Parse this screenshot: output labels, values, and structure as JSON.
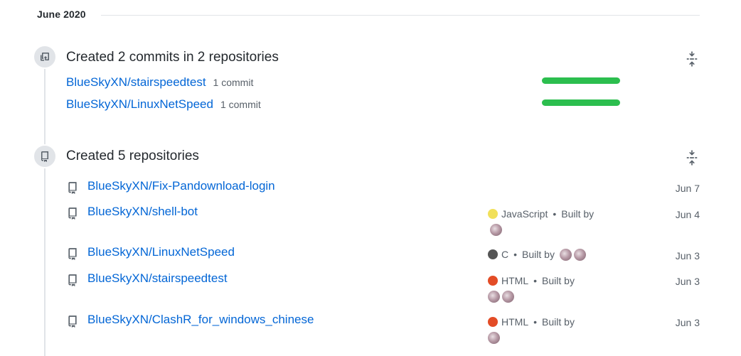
{
  "month": "June 2020",
  "commits_event": {
    "title": "Created 2 commits in 2 repositories",
    "items": [
      {
        "repo": "BlueSkyXN/stairspeedtest",
        "count": "1 commit",
        "bar_fraction": 1.0
      },
      {
        "repo": "BlueSkyXN/LinuxNetSpeed",
        "count": "1 commit",
        "bar_fraction": 1.0
      }
    ],
    "bar_color": "#2cbe4e"
  },
  "repos_event": {
    "title": "Created 5 repositories",
    "items": [
      {
        "repo": "BlueSkyXN/Fix-Pandownload-login",
        "language": "",
        "lang_color": "",
        "built_by": "",
        "avatars": 0,
        "date": "Jun 7"
      },
      {
        "repo": "BlueSkyXN/shell-bot",
        "language": "JavaScript",
        "lang_color": "#f1e05a",
        "sep": "•",
        "built_by": "Built by",
        "avatars": 1,
        "date": "Jun 4"
      },
      {
        "repo": "BlueSkyXN/LinuxNetSpeed",
        "language": "C",
        "lang_color": "#555555",
        "sep": "•",
        "built_by": "Built by",
        "avatars": 2,
        "date": "Jun 3"
      },
      {
        "repo": "BlueSkyXN/stairspeedtest",
        "language": "HTML",
        "lang_color": "#e34c26",
        "sep": "•",
        "built_by": "Built by",
        "avatars": 2,
        "date": "Jun 3"
      },
      {
        "repo": "BlueSkyXN/ClashR_for_windows_chinese",
        "language": "HTML",
        "lang_color": "#e34c26",
        "sep": "•",
        "built_by": "Built by",
        "avatars": 1,
        "date": "Jun 3"
      }
    ]
  },
  "icons": {
    "commit_event": "repo-push-icon",
    "repo_event": "repo-icon",
    "collapse": "fold-icon",
    "repo_row": "repo-icon"
  },
  "colors": {
    "link": "#0366d6",
    "muted": "#586069",
    "timeline": "#e1e4e8"
  }
}
